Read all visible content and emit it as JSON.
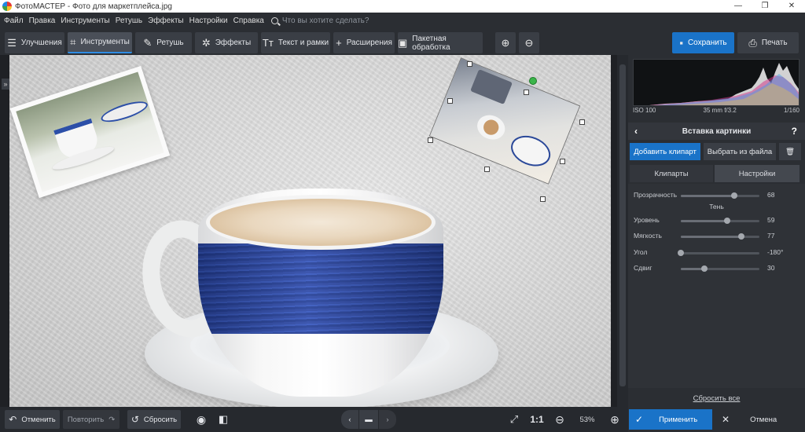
{
  "window": {
    "title": "ФотоМАСТЕР - Фото для маркетплейса.jpg",
    "controls": [
      "—",
      "❐",
      "✕"
    ]
  },
  "menu": {
    "items": [
      "Файл",
      "Правка",
      "Инструменты",
      "Ретушь",
      "Эффекты",
      "Настройки",
      "Справка"
    ],
    "search_placeholder": "Что вы хотите сделать?"
  },
  "toolbar": {
    "tabs": [
      "Улучшения",
      "Инструменты",
      "Ретушь",
      "Эффекты",
      "Текст и рамки",
      "Расширения"
    ],
    "active_tab": "Инструменты",
    "batch_label": "Пакетная обработка",
    "save_label": "Сохранить",
    "print_label": "Печать"
  },
  "histogram": {
    "iso": "ISO 100",
    "lens": "35 mm f/3.2",
    "shutter": "1/160"
  },
  "panel": {
    "title": "Вставка картинки",
    "add_clipart": "Добавить клипарт",
    "choose_file": "Выбрать из файла",
    "tabs": [
      "Клипарты",
      "Настройки"
    ],
    "active_tab": "Настройки",
    "transparency": {
      "label": "Прозрачность",
      "value": 68
    },
    "shadow_heading": "Тень",
    "sliders": [
      {
        "label": "Уровень",
        "value": 59,
        "display": "59"
      },
      {
        "label": "Мягкость",
        "value": 77,
        "display": "77"
      },
      {
        "label": "Угол",
        "value": -180,
        "display": "-180°"
      },
      {
        "label": "Сдвиг",
        "value": 30,
        "display": "30"
      }
    ],
    "reset_all": "Сбросить все"
  },
  "bottom": {
    "undo": "Отменить",
    "redo": "Повторить",
    "reset": "Сбросить",
    "fit_label": "1:1",
    "zoom": "53%",
    "apply": "Применить",
    "cancel": "Отмена"
  },
  "colors": {
    "accent": "#1a73c8",
    "background": "#26292e",
    "cup_band": "#2d49a8",
    "rotate_handle": "#3bb54a"
  }
}
